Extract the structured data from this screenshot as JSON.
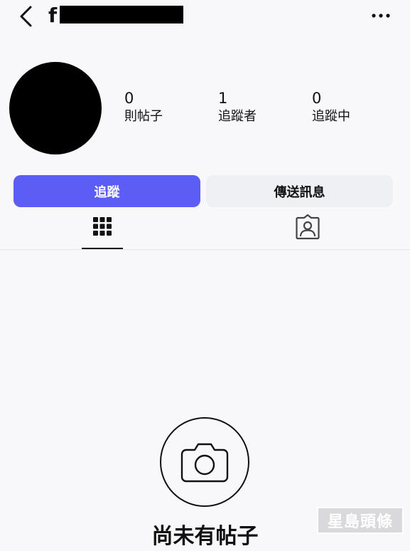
{
  "header": {
    "username_visible": "f",
    "back_icon": "chevron-left-icon",
    "more_icon": "more-horizontal-icon"
  },
  "profile": {
    "stats": [
      {
        "value": "0",
        "label": "則帖子"
      },
      {
        "value": "1",
        "label": "追蹤者"
      },
      {
        "value": "0",
        "label": "追蹤中"
      }
    ]
  },
  "actions": {
    "follow_label": "追蹤",
    "message_label": "傳送訊息",
    "follow_color": "#5b5df5"
  },
  "tabs": {
    "grid_icon": "grid-icon",
    "tagged_icon": "tagged-person-icon"
  },
  "empty_state": {
    "icon": "camera-icon",
    "title": "尚未有帖子"
  },
  "watermark": {
    "text": "星島頭條"
  }
}
